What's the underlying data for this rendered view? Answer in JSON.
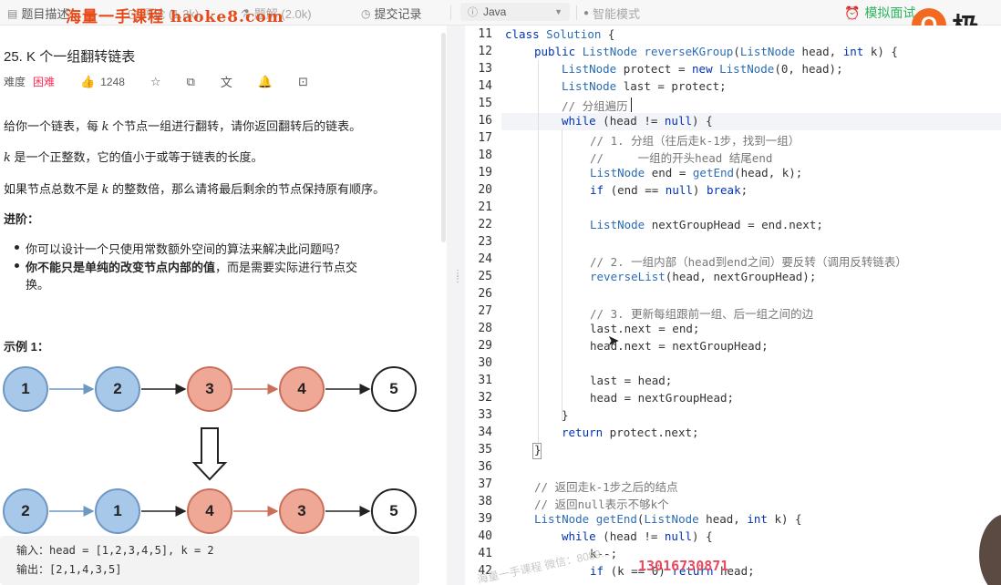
{
  "tabs": {
    "description": "题目描述",
    "comments": "评论 (1.3k)",
    "solutions": "题解 (2.0k)",
    "submissions": "提交记录",
    "language": "Java",
    "smart_mode": "智能模式",
    "mock_interview": "模拟面试"
  },
  "watermark_top": "海量一手课程 haoke8.com",
  "brand": {
    "badge": "Q",
    "text": "极"
  },
  "problem": {
    "title": "25. K 个一组翻转链表",
    "difficulty_label": "难度",
    "difficulty": "困难",
    "likes": "1248",
    "desc1_a": "给你一个链表，每 ",
    "desc1_k": "k",
    "desc1_b": " 个节点一组进行翻转，请你返回翻转后的链表。",
    "desc2_k": "k",
    "desc2_b": " 是一个正整数，它的值小于或等于链表的长度。",
    "desc3_a": "如果节点总数不是 ",
    "desc3_k": "k",
    "desc3_b": " 的整数倍，那么请将最后剩余的节点保持原有顺序。",
    "advanced": "进阶：",
    "bullet1": "你可以设计一个只使用常数额外空间的算法来解决此问题吗？",
    "bullet2_bold": "你不能只是单纯的改变节点内部的值",
    "bullet2_rest": "，而是需要实际进行节点交",
    "bullet2_line2": "换。",
    "example_title": "示例 1：",
    "nodes_top": [
      "1",
      "2",
      "3",
      "4",
      "5"
    ],
    "nodes_bottom": [
      "2",
      "1",
      "4",
      "3",
      "5"
    ],
    "example_input": "输入：head = [1,2,3,4,5], k = 2",
    "example_output": "输出：[2,1,4,3,5]"
  },
  "code": {
    "line_numbers": [
      "11",
      "12",
      "13",
      "14",
      "15",
      "16",
      "17",
      "18",
      "19",
      "20",
      "21",
      "22",
      "23",
      "24",
      "25",
      "26",
      "27",
      "28",
      "29",
      "30",
      "31",
      "32",
      "33",
      "34",
      "35",
      "36",
      "37",
      "38",
      "39",
      "40",
      "41",
      "42"
    ],
    "l11_k": "class",
    "l11_t": "Solution",
    "l11_r": " {",
    "l12_k": "public",
    "l12_t": "ListNode",
    "l12_f": "reverseKGroup",
    "l12_a": "(",
    "l12_t2": "ListNode",
    "l12_b": " head, ",
    "l12_k2": "int",
    "l12_c": " k) {",
    "l13_t": "ListNode",
    "l13_a": " protect = ",
    "l13_k": "new",
    "l13_t2": "ListNode",
    "l13_b": "(0, head);",
    "l14_t": "ListNode",
    "l14_a": " last = protect;",
    "l15_c": "// 分组遍历",
    "l16_k": "while",
    "l16_a": " (head != ",
    "l16_k2": "null",
    "l16_b": ") {",
    "l17_c": "// 1. 分组（往后走k-1步，找到一组）",
    "l18_c": "//     一组的开头head 结尾end",
    "l19_t": "ListNode",
    "l19_a": " end = ",
    "l19_f": "getEnd",
    "l19_b": "(head, k);",
    "l20_k": "if",
    "l20_a": " (end == ",
    "l20_k2": "null",
    "l20_b": ") ",
    "l20_k3": "break",
    "l20_c": ";",
    "l22_t": "ListNode",
    "l22_a": " nextGroupHead = end.next;",
    "l24_c": "// 2. 一组内部（head到end之间）要反转（调用反转链表）",
    "l25_f": "reverseList",
    "l25_a": "(head, nextGroupHead);",
    "l27_c": "// 3. 更新每组跟前一组、后一组之间的边",
    "l28": "last.next = end;",
    "l29": "head.next = nextGroupHead;",
    "l31": "last = head;",
    "l32": "head = nextGroupHead;",
    "l33": "}",
    "l34_k": "return",
    "l34_a": " protect.next;",
    "l35": "}",
    "l37_c": "// 返回走k-1步之后的结点",
    "l38_c": "// 返回null表示不够k个",
    "l39_t": "ListNode",
    "l39_f": "getEnd",
    "l39_a": "(",
    "l39_t2": "ListNode",
    "l39_b": " head, ",
    "l39_k": "int",
    "l39_c": " k) {",
    "l40_k": "while",
    "l40_a": " (head != ",
    "l40_k2": "null",
    "l40_b": ") {",
    "l41": "k--;",
    "l42_k": "if",
    "l42_a": " (k == 0) ",
    "l42_k2": "return",
    "l42_b": " head;"
  },
  "phone_overlay": "13016730871",
  "watermark_diag": "海量一手课程 微信：8089..."
}
